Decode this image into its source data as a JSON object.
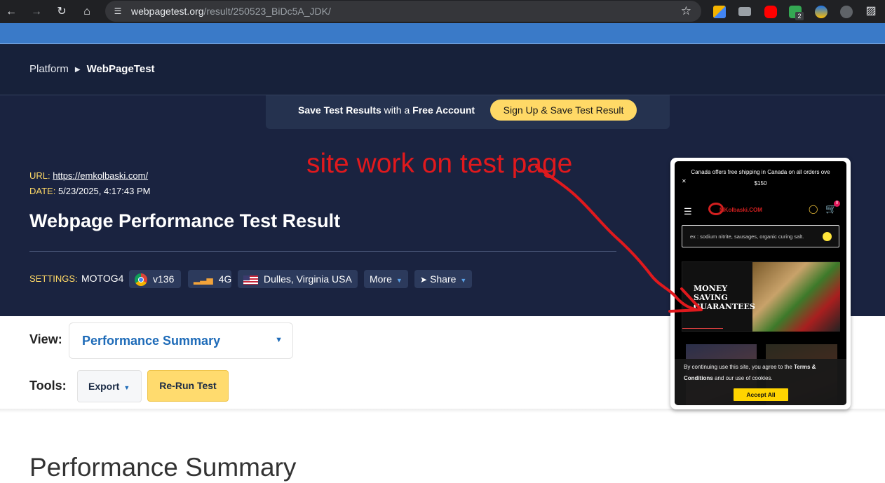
{
  "browser": {
    "url_host": "webpagetest.org",
    "url_path": "/result/250523_BiDc5A_JDK/",
    "badge_count": "2"
  },
  "breadcrumb": {
    "parent": "Platform",
    "current": "WebPageTest"
  },
  "promo": {
    "text_bold_1": "Save Test Results",
    "text_mid": " with a ",
    "text_bold_2": "Free Account",
    "button": "Sign Up & Save Test Result"
  },
  "result": {
    "url_label": "URL:",
    "url_value": "https://emkolbaski.com/",
    "date_label": "DATE:",
    "date_value": "5/23/2025, 4:17:43 PM",
    "title": "Webpage Performance Test Result"
  },
  "settings": {
    "label": "SETTINGS:",
    "device": "MOTOG4",
    "browser": "v136",
    "network": "4G",
    "location": "Dulles, Virginia USA",
    "more": "More",
    "share": "Share"
  },
  "view": {
    "label": "View:",
    "selected": "Performance Summary"
  },
  "tools": {
    "label": "Tools:",
    "export": "Export",
    "rerun": "Re-Run Test"
  },
  "section_heading": "Performance Summary",
  "annotation": "site work on test page",
  "mobile": {
    "promo_line1": "Canada offers free shipping in Canada on all orders ove",
    "promo_line2": "$150",
    "brand": "MKolbaski.COM",
    "cart_count": "0",
    "search_placeholder": "ex : sodium nitrite, sausages, organic curing salt.",
    "banner_text": "MONEY\nSAVING\nGUARANTEES",
    "cookie_text_1": "By continuing use this site, you agree to the ",
    "cookie_terms": "Terms & Conditions",
    "cookie_text_2": " and our use of cookies.",
    "cookie_accept": "Accept All"
  },
  "colors": {
    "accent_yellow": "#ffd966",
    "dark_bg": "#1a2340",
    "link_blue": "#1e6bb8",
    "annotation_red": "#e0191d"
  }
}
